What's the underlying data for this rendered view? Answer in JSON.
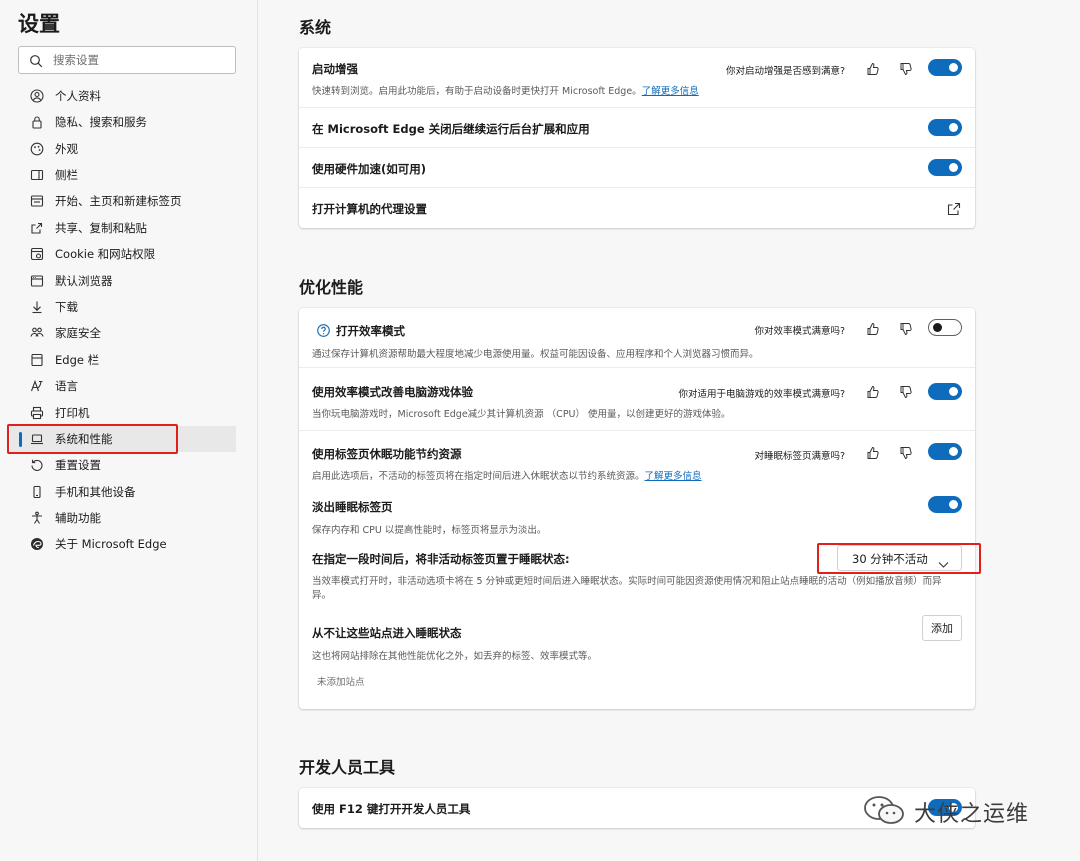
{
  "sidebar": {
    "title": "设置",
    "search_placeholder": "搜索设置",
    "items": [
      {
        "label": "个人资料",
        "icon": "profile-icon"
      },
      {
        "label": "隐私、搜索和服务",
        "icon": "lock-icon"
      },
      {
        "label": "外观",
        "icon": "appearance-icon"
      },
      {
        "label": "侧栏",
        "icon": "sidebar-icon"
      },
      {
        "label": "开始、主页和新建标签页",
        "icon": "home-icon"
      },
      {
        "label": "共享、复制和粘贴",
        "icon": "share-icon"
      },
      {
        "label": "Cookie 和网站权限",
        "icon": "cookie-icon"
      },
      {
        "label": "默认浏览器",
        "icon": "browser-icon"
      },
      {
        "label": "下载",
        "icon": "download-icon"
      },
      {
        "label": "家庭安全",
        "icon": "family-icon"
      },
      {
        "label": "Edge 栏",
        "icon": "edge-bar-icon"
      },
      {
        "label": "语言",
        "icon": "language-icon"
      },
      {
        "label": "打印机",
        "icon": "printer-icon"
      },
      {
        "label": "系统和性能",
        "icon": "laptop-icon",
        "active": true
      },
      {
        "label": "重置设置",
        "icon": "reset-icon"
      },
      {
        "label": "手机和其他设备",
        "icon": "phone-icon"
      },
      {
        "label": "辅助功能",
        "icon": "accessibility-icon"
      },
      {
        "label": "关于 Microsoft Edge",
        "icon": "edge-logo-icon"
      }
    ]
  },
  "system": {
    "title": "系统",
    "startup_boost": {
      "title": "启动增强",
      "question": "你对启动增强是否感到满意?",
      "desc": "快速转到浏览。启用此功能后，有助于启动设备时更快打开 Microsoft Edge。",
      "link": "了解更多信息",
      "enabled": true
    },
    "background": {
      "title": "在 Microsoft Edge 关闭后继续运行后台扩展和应用",
      "enabled": true
    },
    "hardware": {
      "title": "使用硬件加速(如可用)",
      "enabled": true
    },
    "proxy": {
      "title": "打开计算机的代理设置"
    }
  },
  "performance": {
    "title": "优化性能",
    "efficiency": {
      "title": "打开效率模式",
      "question": "你对效率模式满意吗?",
      "desc": "通过保存计算机资源帮助最大程度地减少电源使用量。权益可能因设备、应用程序和个人浏览器习惯而异。",
      "enabled": false
    },
    "gaming": {
      "title": "使用效率模式改善电脑游戏体验",
      "question": "你对适用于电脑游戏的效率模式满意吗?",
      "desc": "当你玩电脑游戏时，Microsoft Edge减少其计算机资源 （CPU） 使用量，以创建更好的游戏体验。",
      "enabled": true
    },
    "sleeping": {
      "title": "使用标签页休眠功能节约资源",
      "question": "对睡眠标签页满意吗?",
      "desc": "启用此选项后，不活动的标签页将在指定时间后进入休眠状态以节约系统资源。",
      "link": "了解更多信息",
      "enabled": true
    },
    "fade": {
      "title": "淡出睡眠标签页",
      "desc": "保存内存和 CPU 以提高性能时，标签页将显示为淡出。",
      "enabled": true
    },
    "timeout": {
      "title": "在指定一段时间后，将非活动标签页置于睡眠状态:",
      "value": "30 分钟不活动",
      "desc_line1": "当效率模式打开时，非活动选项卡将在 5 分钟或更短时间后进入睡眠状态。实际时间可能因资源使用情况和阻止站点睡眠的活动（例如播放音频）而异",
      "desc_line2": "异。"
    },
    "never_sleep": {
      "title": "从不让这些站点进入睡眠状态",
      "desc": "这也将网站排除在其他性能优化之外，如丢弃的标签、效率模式等。",
      "button": "添加",
      "empty": "未添加站点"
    }
  },
  "devtools": {
    "title": "开发人员工具",
    "f12": {
      "title": "使用 F12 键打开开发人员工具",
      "enabled": true
    }
  },
  "watermark": {
    "text": "大侠之运维"
  },
  "colors": {
    "accent": "#0f6cbd",
    "highlight": "#e0201b"
  }
}
